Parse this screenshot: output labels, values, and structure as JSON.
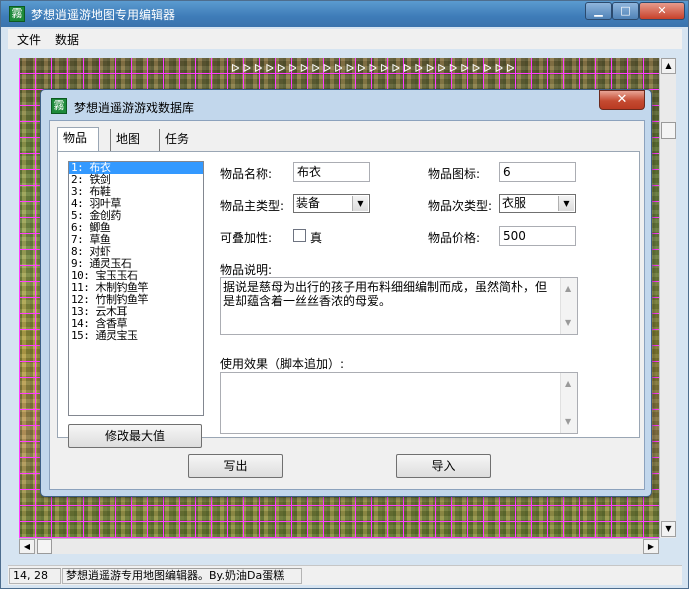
{
  "app": {
    "title": "梦想逍遥游地图专用编辑器"
  },
  "menu": {
    "items": [
      "文件",
      "数据"
    ]
  },
  "window_controls": {
    "minimize": "▁",
    "maximize": "□",
    "close": "✕"
  },
  "map": {
    "row_markers": "ᐅᐅᐅᐅᐅᐅᐅᐅᐅᐅᐅᐅᐅᐅᐅᐅᐅᐅᐅᐅᐅᐅᐅᐅᐅ"
  },
  "status": {
    "coords": "14, 28",
    "info": "梦想逍遥游专用地图编辑器。By.奶油Da蛋糕"
  },
  "dialog": {
    "title": "梦想逍遥游游戏数据库",
    "close": "✕",
    "tabs": [
      {
        "label": "物品"
      },
      {
        "label": "地图"
      },
      {
        "label": "任务"
      }
    ],
    "items": [
      "1: 布衣",
      "2: 铁剑",
      "3: 布鞋",
      "4: 羽叶草",
      "5: 金创药",
      "6: 鲫鱼",
      "7: 草鱼",
      "8: 对虾",
      "9: 通灵玉石",
      "10: 宝玉玉石",
      "11: 木制钓鱼竿",
      "12: 竹制钓鱼竿",
      "13: 云木耳",
      "14: 含香草",
      "15: 通灵宝玉"
    ],
    "selected_index": 0,
    "modify_max_button": "修改最大值",
    "fields": {
      "name_label": "物品名称:",
      "name_value": "布衣",
      "icon_label": "物品图标:",
      "icon_value": "6",
      "main_type_label": "物品主类型:",
      "main_type_value": "装备",
      "sub_type_label": "物品次类型:",
      "sub_type_value": "衣服",
      "stackable_label": "可叠加性:",
      "stackable_checkbox_label": "真",
      "stackable_checked": false,
      "price_label": "物品价格:",
      "price_value": "500",
      "desc_label": "物品说明:",
      "desc_value": "据说是慈母为出行的孩子用布料细细编制而成，虽然简朴，但是却蕴含着一丝丝香浓的母爱。",
      "effect_label": "使用效果（脚本追加）:",
      "effect_value": ""
    },
    "export_button": "写出",
    "import_button": "导入"
  }
}
